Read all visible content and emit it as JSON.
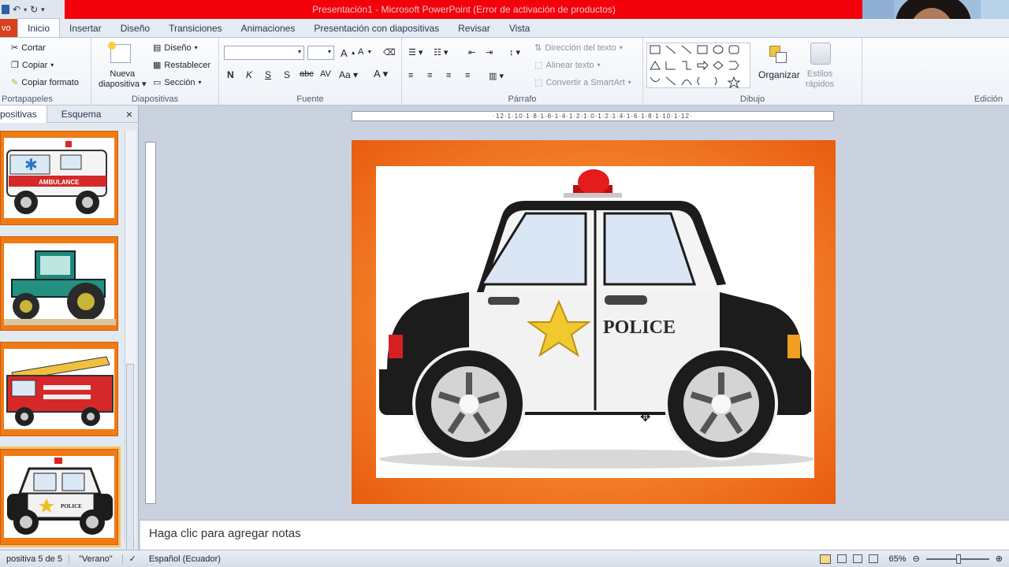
{
  "window": {
    "title": "Presentación1  -  Microsoft PowerPoint (Error de activación de productos)",
    "title_bar_color": "#f2000c"
  },
  "tabs": [
    {
      "label": "vo"
    },
    {
      "label": "Inicio"
    },
    {
      "label": "Insertar"
    },
    {
      "label": "Diseño"
    },
    {
      "label": "Transiciones"
    },
    {
      "label": "Animaciones"
    },
    {
      "label": "Presentación con diapositivas"
    },
    {
      "label": "Revisar"
    },
    {
      "label": "Vista"
    }
  ],
  "ribbon": {
    "portapapeles": {
      "cut": "Cortar",
      "copy": "Copiar",
      "format": "Copiar formato",
      "name": "Portapapeles"
    },
    "diapositivas": {
      "new": "Nueva",
      "new2": "diapositiva",
      "layout": "Diseño",
      "reset": "Restablecer",
      "section": "Sección",
      "name": "Diapositivas"
    },
    "fuente": {
      "bold": "N",
      "italic": "K",
      "underline": "S",
      "strike": "S",
      "spacing": "abc",
      "case": "AV",
      "name": "Fuente"
    },
    "parrafo": {
      "direction": "Dirección del texto",
      "align": "Alinear texto",
      "smartart": "Convertir a SmartArt",
      "name": "Párrafo"
    },
    "dibujo": {
      "arrange": "Organizar",
      "quick1": "Estilos",
      "quick2": "rápidos",
      "name": "Dibujo"
    },
    "edicion": {
      "name": "Edición"
    }
  },
  "leftpane": {
    "tab_slides": "positivas",
    "tab_outline": "Esquema",
    "close": "×",
    "thumbnails": [
      {
        "subject": "ambulance",
        "label": "AMBULANCE"
      },
      {
        "subject": "tractor"
      },
      {
        "subject": "fire-truck"
      },
      {
        "subject": "police-car",
        "label": "POLICE",
        "selected": true
      }
    ]
  },
  "ruler": {
    "labels": "·12·1·10·1·8·1·6·1·4·1·2·1·0·1·2·1·4·1·6·1·8·1·10·1·12·"
  },
  "slide": {
    "image": "police-car",
    "text": "POLICE",
    "frame_color": "#f4822a"
  },
  "notes": {
    "placeholder": "Haga clic para agregar notas"
  },
  "statusbar": {
    "slide_info": "positiva 5 de 5",
    "theme": "\"Verano\"",
    "language": "Español (Ecuador)",
    "zoom": "65%"
  }
}
